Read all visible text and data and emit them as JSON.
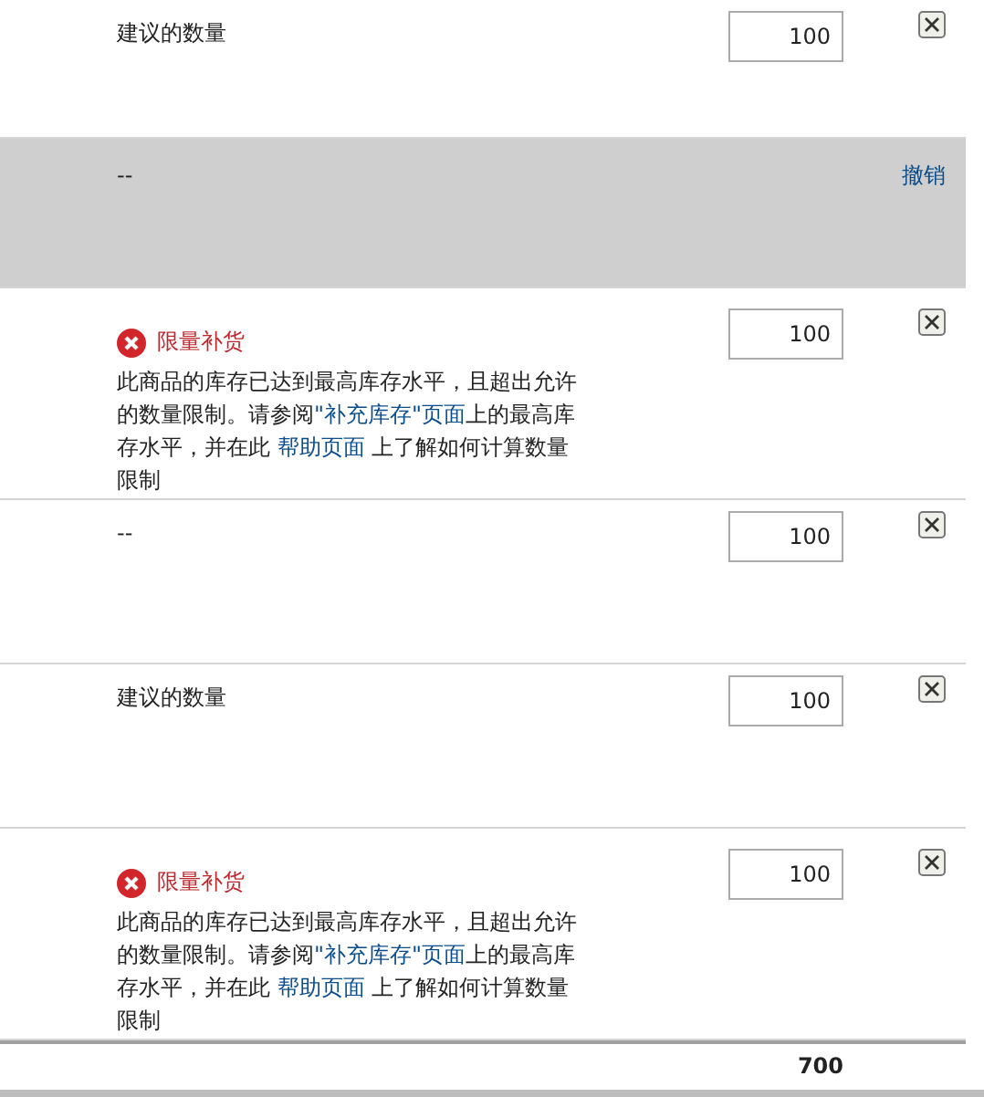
{
  "rows": [
    {
      "kind": "note",
      "label": "建议的数量",
      "quantity": "100"
    },
    {
      "kind": "removed",
      "label": "--",
      "undo": "撤销"
    },
    {
      "kind": "warning",
      "title": "限量补货",
      "message": {
        "before": "此商品的库存已达到最高库存水平，且超出允许的数量限制。请参阅",
        "link1": "\"补充库存\"页面",
        "middle": "上的最高库存水平，并在此 ",
        "link2": "帮助页面",
        "after": " 上了解如何计算数量限制"
      },
      "quantity": "100"
    },
    {
      "kind": "note",
      "label": "--",
      "quantity": "100"
    },
    {
      "kind": "note",
      "label": "建议的数量",
      "quantity": "100"
    },
    {
      "kind": "warning",
      "title": "限量补货",
      "message": {
        "before": "此商品的库存已达到最高库存水平，且超出允许的数量限制。请参阅",
        "link1": "\"补充库存\"页面",
        "middle": "上的最高库存水平，并在此 ",
        "link2": "帮助页面",
        "after": " 上了解如何计算数量限制"
      },
      "quantity": "100"
    }
  ],
  "total": "700"
}
